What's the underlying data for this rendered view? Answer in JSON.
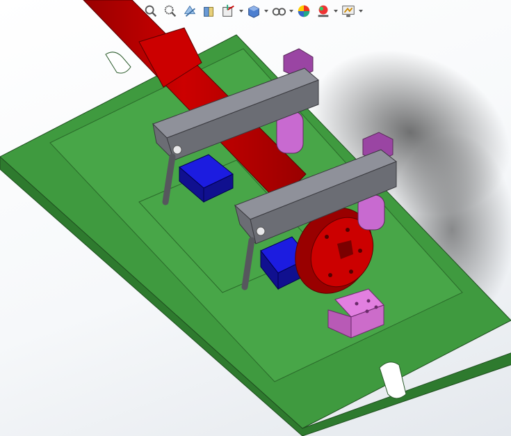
{
  "toolbar": {
    "buttons": [
      {
        "name": "zoom-to-fit-button",
        "icon": "zoom-to-fit-icon"
      },
      {
        "name": "zoom-to-area-button",
        "icon": "zoom-to-area-icon"
      },
      {
        "name": "previous-view-button",
        "icon": "previous-view-icon"
      },
      {
        "name": "section-view-button",
        "icon": "section-view-icon"
      },
      {
        "name": "view-orientation-button",
        "icon": "view-orientation-icon",
        "dropdown": true
      },
      {
        "name": "display-style-button",
        "icon": "display-style-icon",
        "dropdown": true
      },
      {
        "name": "hide-show-items-button",
        "icon": "hide-show-items-icon",
        "dropdown": true
      },
      {
        "name": "edit-appearance-button",
        "icon": "edit-appearance-icon"
      },
      {
        "name": "apply-scene-button",
        "icon": "apply-scene-icon",
        "dropdown": true
      },
      {
        "name": "view-settings-button",
        "icon": "view-settings-icon",
        "dropdown": true
      }
    ]
  },
  "colors": {
    "base_plate": "#3f9a3f",
    "base_plate_dark": "#2e7a2e",
    "sub_plate": "#48a648",
    "shaft": "#cc0000",
    "shaft_dark": "#990000",
    "clamp_arm": "#8f919a",
    "clamp_arm_dark": "#6b6d74",
    "support_block": "#1c1ce0",
    "support_block_dark": "#10108f",
    "stud_nut": "#c86ad0",
    "stud_nut_dark": "#9a45a3",
    "locator_block": "#e27fe0",
    "pin": "#56575d"
  },
  "model": {
    "parts": [
      "base-plate",
      "sub-plate",
      "shaft",
      "clamp-arm",
      "support-block",
      "stud-nut",
      "locator-block"
    ]
  }
}
